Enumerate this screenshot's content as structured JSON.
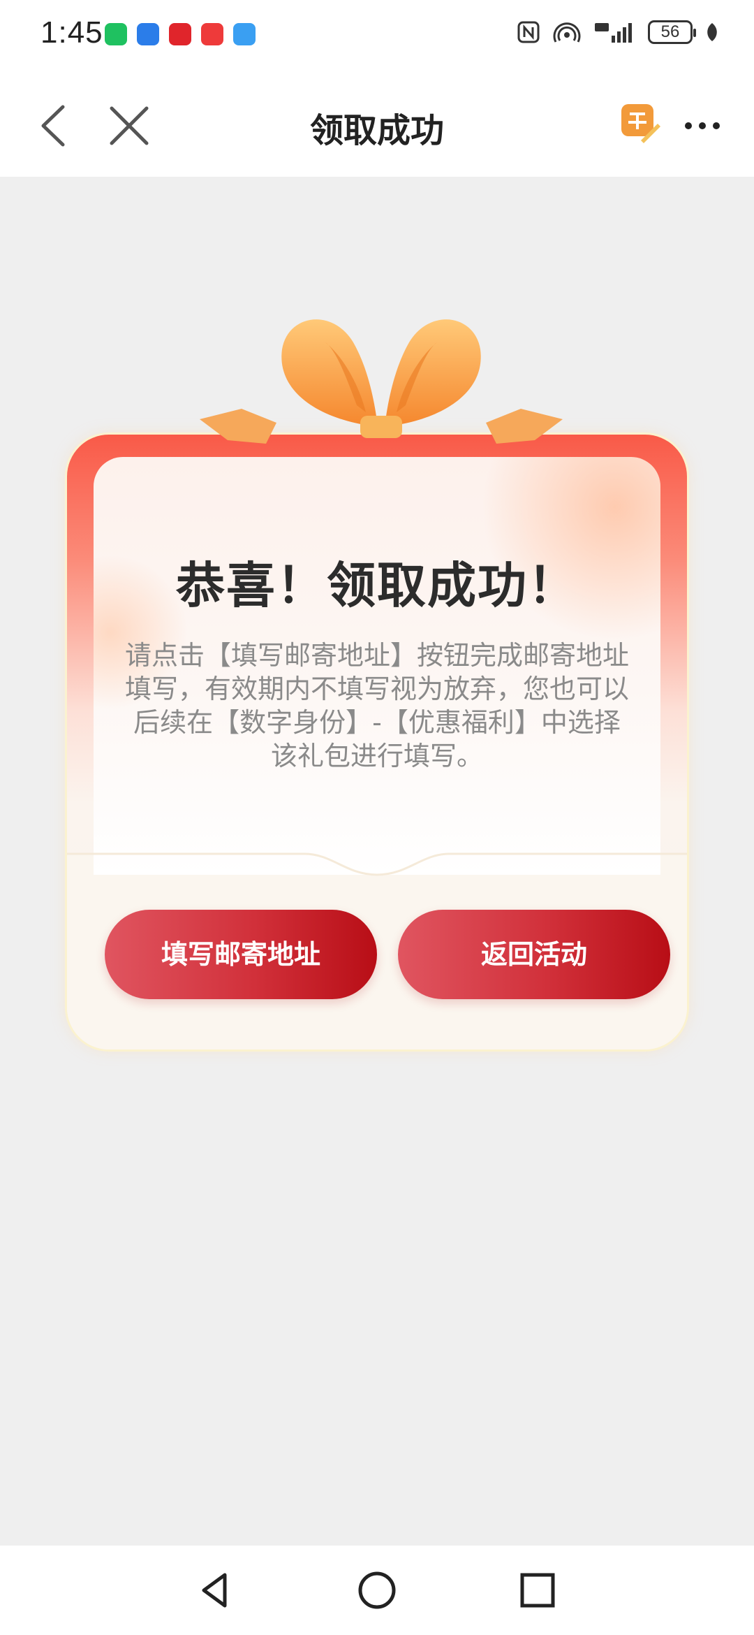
{
  "status_bar": {
    "time": "1:45",
    "apps": [
      "wechat-icon",
      "yupao-app-icon",
      "heart-app-icon",
      "red-book-icon",
      "weather-icon"
    ],
    "battery": "56"
  },
  "header": {
    "title": "领取成功"
  },
  "card": {
    "headline": "恭喜！领取成功！",
    "description": "请点击【填写邮寄地址】按钮完成邮寄地址填写，有效期内不填写视为放弃，您也可以后续在【数字身份】-【优惠福利】中选择该礼包进行填写。",
    "buttons": {
      "fill_address": "填写邮寄地址",
      "back_to_event": "返回活动"
    }
  },
  "colors": {
    "accent_red": "#c91f29",
    "bow_orange": "#f7a24a",
    "card_top_red": "#f95a48"
  }
}
